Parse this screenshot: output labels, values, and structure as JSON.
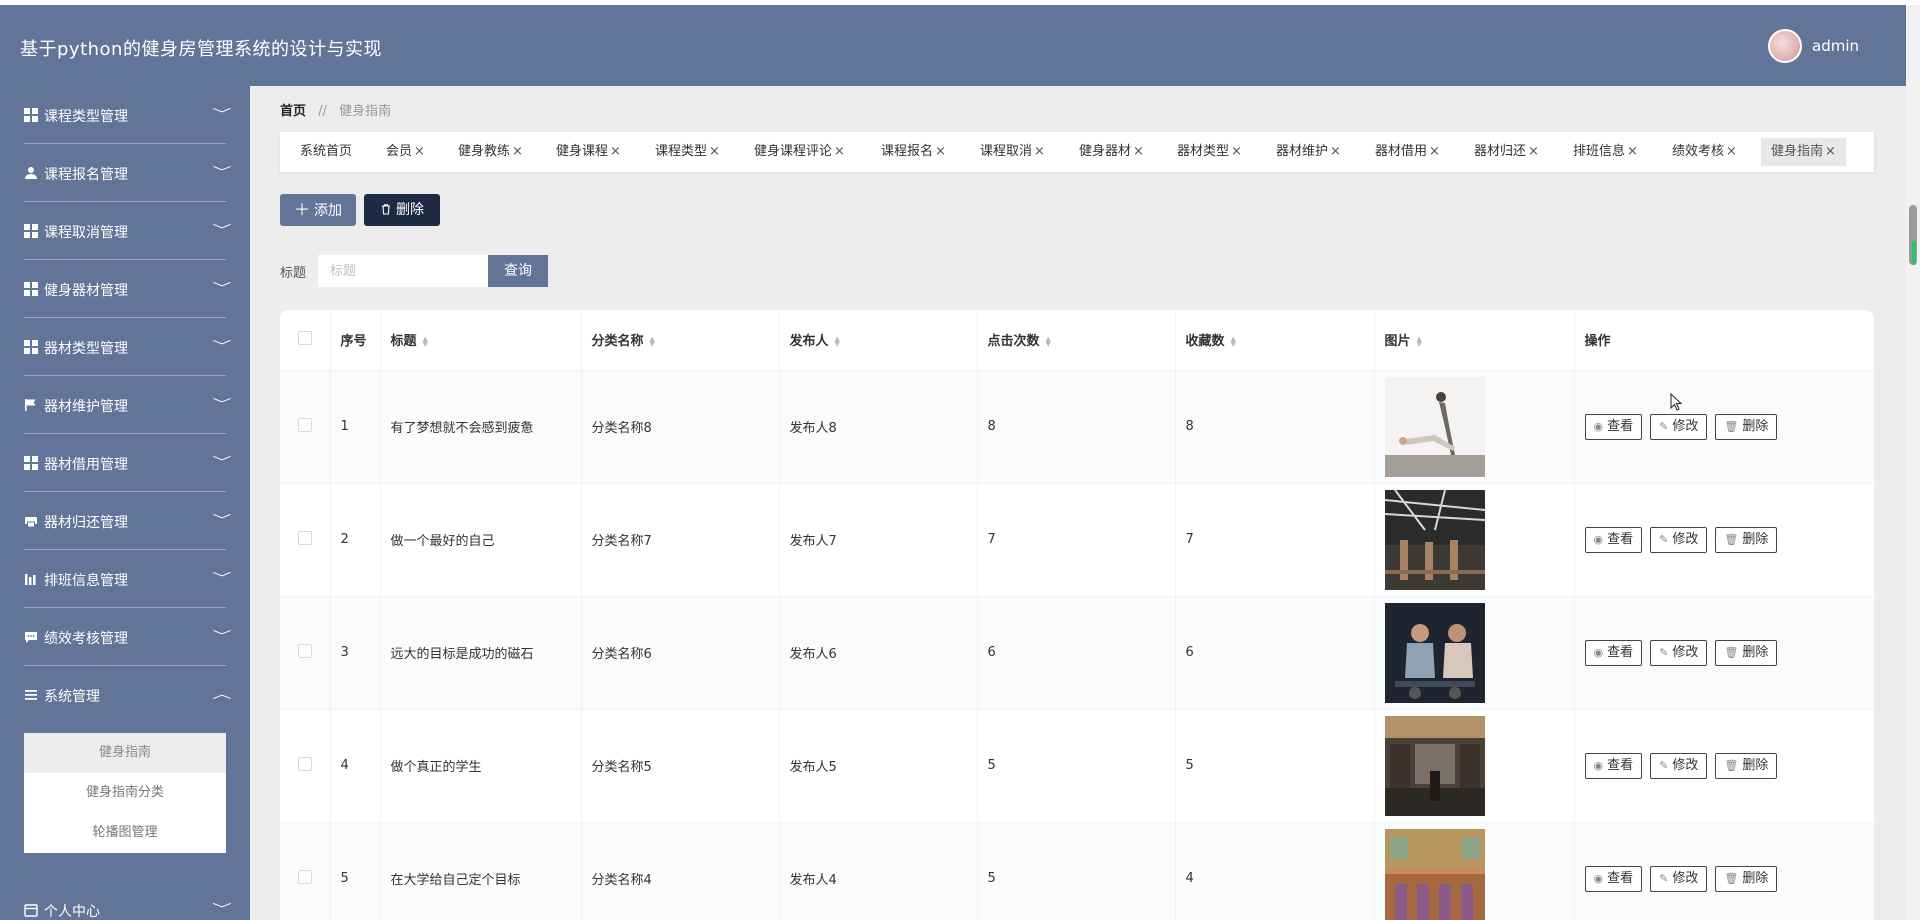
{
  "header": {
    "title": "基于python的健身房管理系统的设计与实现",
    "username": "admin"
  },
  "sidebar": {
    "items": [
      {
        "label": "课程类型管理",
        "icon": "grid-icon"
      },
      {
        "label": "课程报名管理",
        "icon": "user-icon"
      },
      {
        "label": "课程取消管理",
        "icon": "grid-icon"
      },
      {
        "label": "健身器材管理",
        "icon": "grid-icon"
      },
      {
        "label": "器材类型管理",
        "icon": "grid-icon"
      },
      {
        "label": "器材维护管理",
        "icon": "flag-icon"
      },
      {
        "label": "器材借用管理",
        "icon": "grid-icon"
      },
      {
        "label": "器材归还管理",
        "icon": "printer-icon"
      },
      {
        "label": "排班信息管理",
        "icon": "bar-chart-icon"
      },
      {
        "label": "绩效考核管理",
        "icon": "chat-icon"
      },
      {
        "label": "系统管理",
        "icon": "list-icon"
      },
      {
        "label": "个人中心",
        "icon": "calendar-icon"
      }
    ],
    "submenu": [
      "健身指南",
      "健身指南分类",
      "轮播图管理"
    ]
  },
  "breadcrumb": {
    "home": "首页",
    "separator": "//",
    "current": "健身指南"
  },
  "tags": [
    "系统首页",
    "会员",
    "健身教练",
    "健身课程",
    "课程类型",
    "健身课程评论",
    "课程报名",
    "课程取消",
    "健身器材",
    "器材类型",
    "器材维护",
    "器材借用",
    "器材归还",
    "排班信息",
    "绩效考核",
    "健身指南"
  ],
  "toolbar": {
    "add_label": "添加",
    "delete_label": "删除"
  },
  "search": {
    "label": "标题",
    "placeholder": "标题",
    "button": "查询"
  },
  "table": {
    "headers": [
      "序号",
      "标题",
      "分类名称",
      "发布人",
      "点击次数",
      "收藏数",
      "图片",
      "操作"
    ],
    "rows": [
      {
        "idx": "1",
        "title": "有了梦想就不会感到疲惫",
        "category": "分类名称8",
        "author": "发布人8",
        "clicks": "8",
        "favs": "8",
        "img": "yoga-stretch"
      },
      {
        "idx": "2",
        "title": "做一个最好的自己",
        "category": "分类名称7",
        "author": "发布人7",
        "clicks": "7",
        "favs": "7",
        "img": "gym-interior"
      },
      {
        "idx": "3",
        "title": "远大的目标是成功的磁石",
        "category": "分类名称6",
        "author": "发布人6",
        "clicks": "6",
        "favs": "6",
        "img": "cycling-class"
      },
      {
        "idx": "4",
        "title": "做个真正的学生",
        "category": "分类名称5",
        "author": "发布人5",
        "clicks": "5",
        "favs": "5",
        "img": "gym-corridor"
      },
      {
        "idx": "5",
        "title": "在大学给自己定个目标",
        "category": "分类名称4",
        "author": "发布人4",
        "clicks": "5",
        "favs": "4",
        "img": "yoga-studio"
      }
    ],
    "actions": {
      "view": "查看",
      "edit": "修改",
      "delete": "删除"
    }
  },
  "colors": {
    "primary": "#627599",
    "dark": "#1e2a44",
    "background": "#ededed"
  }
}
